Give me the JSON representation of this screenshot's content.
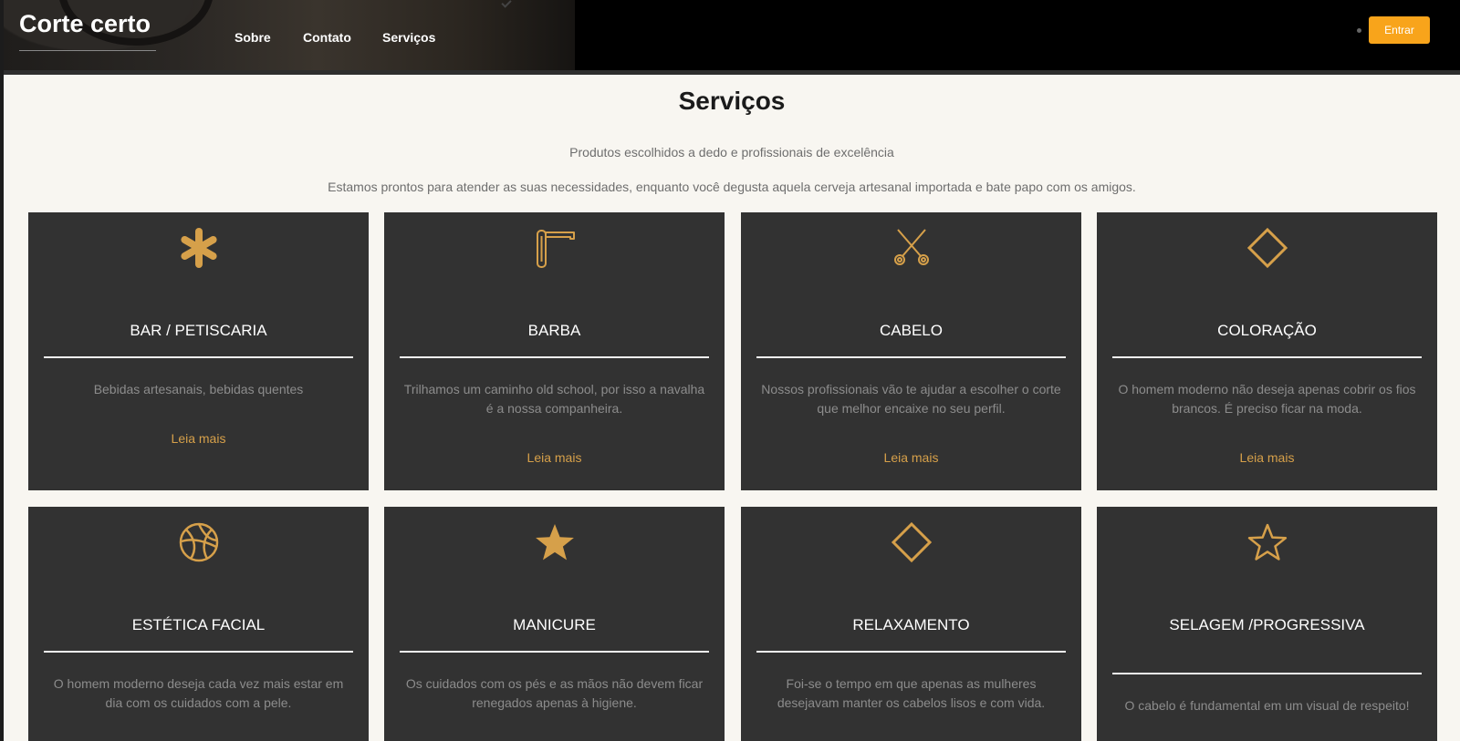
{
  "header": {
    "brand": "Corte certo",
    "nav": [
      "Sobre",
      "Contato",
      "Serviços"
    ],
    "login_label": "Entrar"
  },
  "services": {
    "title": "Serviços",
    "subtitle": "Produtos escolhidos a dedo e profissionais de excelência",
    "description": "Estamos prontos para atender as suas necessidades, enquanto você degusta aquela cerveja artesanal importada e bate papo com os amigos.",
    "read_more": "Leia mais",
    "cards": [
      {
        "title": "BAR / PETISCARIA",
        "text": "Bebidas artesanais, bebidas quentes",
        "icon": "asterisk-icon"
      },
      {
        "title": "BARBA",
        "text": "Trilhamos um caminho old school, por isso a navalha é a nossa companheira.",
        "icon": "razor-icon"
      },
      {
        "title": "CABELO",
        "text": "Nossos profissionais vão te ajudar a escolher o corte que melhor encaixe no seu perfil.",
        "icon": "scissors-icon"
      },
      {
        "title": "COLORAÇÃO",
        "text": "O homem moderno não deseja apenas cobrir os fios brancos. É preciso ficar na moda.",
        "icon": "diamond-icon"
      },
      {
        "title": "ESTÉTICA FACIAL",
        "text": "O homem moderno deseja cada vez mais estar em dia com os cuidados com a pele.",
        "icon": "basketball-icon"
      },
      {
        "title": "MANICURE",
        "text": "Os cuidados com os pés e as mãos não devem ficar renegados apenas à higiene.",
        "icon": "star-filled-icon"
      },
      {
        "title": "RELAXAMENTO",
        "text": "Foi-se o tempo em que apenas as mulheres desejavam manter os cabelos lisos e com vida.",
        "icon": "diamond-icon"
      },
      {
        "title": "SELAGEM /PROGRESSIVA",
        "text": "O cabelo é fundamental em um visual de respeito!",
        "icon": "star-outline-icon"
      }
    ]
  },
  "colors": {
    "accent": "#d6a04a",
    "button": "#f8a41b",
    "card_bg": "#323232",
    "page_bg": "#f8f6f1",
    "header_bg": "#000000"
  }
}
